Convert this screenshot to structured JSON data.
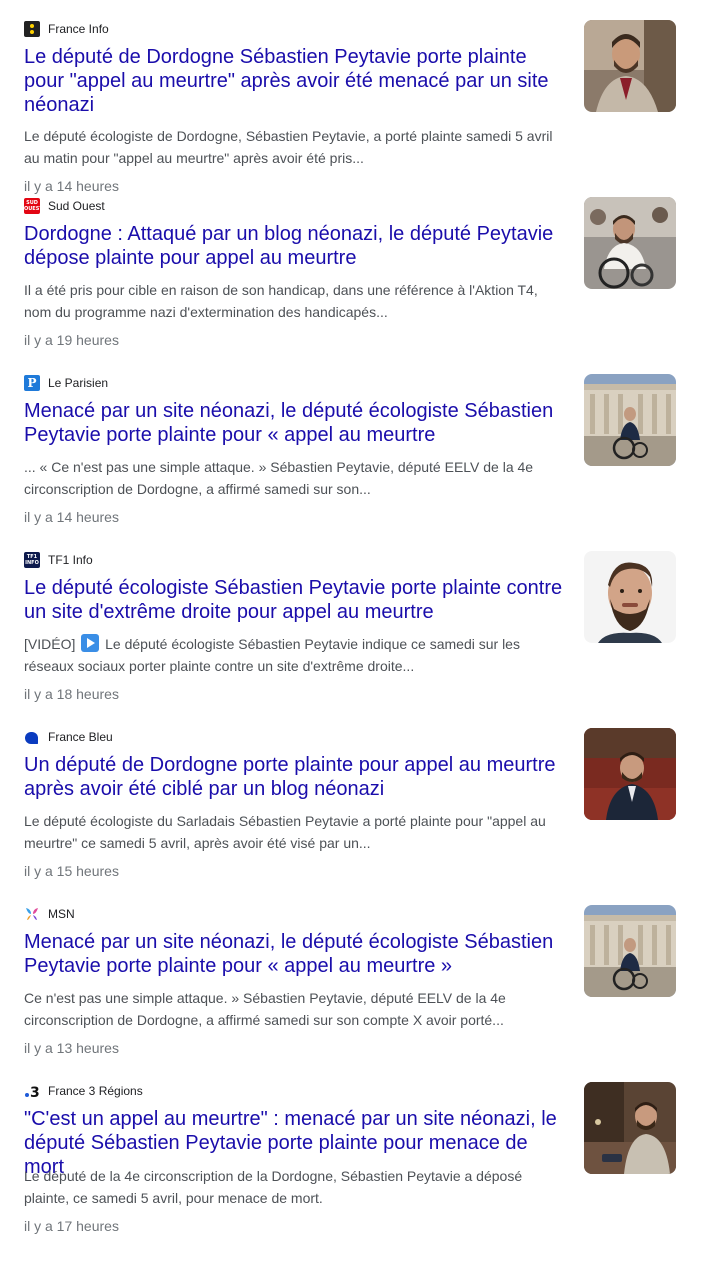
{
  "articles": [
    {
      "source": "France Info",
      "logo": "franceinfo-logo",
      "headline": "Le député de Dordogne Sébastien Peytavie porte plainte pour \"appel au meurtre\" après avoir été menacé par un site néonazi",
      "snippet": "Le député écologiste de Dordogne, Sébastien Peytavie, a porté plainte samedi 5 avril au matin pour \"appel au meurtre\" après avoir été pris...",
      "time": "il y a 14 heures"
    },
    {
      "source": "Sud Ouest",
      "logo": "sudouest-logo",
      "headline": "Dordogne : Attaqué par un blog néonazi, le député Peytavie dépose plainte pour appel au meurtre",
      "snippet": "Il a été pris pour cible en raison de son handicap, dans une référence à l'Aktion T4, nom du programme nazi d'extermination des handicapés...",
      "time": "il y a 19 heures"
    },
    {
      "source": "Le Parisien",
      "logo": "leparisien-logo",
      "headline": "Menacé par un site néonazi, le député écologiste Sébastien Peytavie porte plainte pour « appel au meurtre",
      "snippet": "... « Ce n'est pas une simple attaque. » Sébastien Peytavie, député EELV de la 4e circonscription de Dordogne, a affirmé samedi sur son...",
      "time": "il y a 14 heures"
    },
    {
      "source": "TF1 Info",
      "logo": "tf1info-logo",
      "headline": "Le député écologiste Sébastien Peytavie porte plainte contre un site d'extrême droite pour appel au meurtre",
      "snippet_prefix": "[VIDÉO]",
      "snippet": "Le député écologiste Sébastien Peytavie indique ce samedi sur les réseaux sociaux porter plainte contre un site d'extrême droite...",
      "time": "il y a 18 heures"
    },
    {
      "source": "France Bleu",
      "logo": "francebleu-logo",
      "headline": "Un député de Dordogne porte plainte pour appel au meurtre après avoir été ciblé par un blog néonazi",
      "snippet": "Le député écologiste du Sarladais Sébastien Peytavie a porté plainte pour \"appel au meurtre\" ce samedi 5 avril, après avoir été visé par un...",
      "time": "il y a 15 heures"
    },
    {
      "source": "MSN",
      "logo": "msn-logo",
      "headline": "Menacé par un site néonazi, le député écologiste Sébastien Peytavie porte plainte pour « appel au meurtre »",
      "snippet": "Ce n'est pas une simple attaque. » Sébastien Peytavie, député EELV de la 4e circonscription de Dordogne, a affirmé samedi sur son compte X avoir porté...",
      "time": "il y a 13 heures"
    },
    {
      "source": "France 3 Régions",
      "logo": "france3-logo",
      "headline": "\"C'est un appel au meurtre\" : menacé par un site néonazi, le député Sébastien Peytavie porte plainte pour menace de mort",
      "snippet": "Le député de la 4e circonscription de la Dordogne, Sébastien Peytavie a déposé plainte, ce samedi 5 avril, pour menace de mort.",
      "time": "il y a 17 heures"
    }
  ],
  "logo_text": {
    "sudouest": "SUD OUEST",
    "parisien": "P",
    "tf1": "TF1 INFO",
    "france3": "3"
  },
  "colors": {
    "headline": "#1a0dab",
    "snippet": "#4d5156",
    "time": "#70757a",
    "source": "#202124"
  }
}
